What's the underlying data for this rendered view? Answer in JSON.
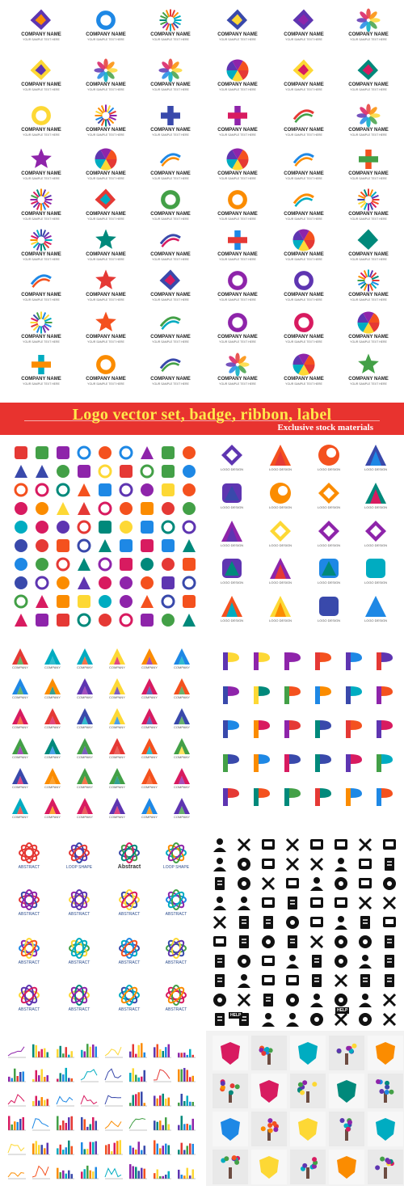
{
  "top_grid": {
    "company_name": "COMPANY NAME",
    "tagline": "YOUR SAMPLE TEXT HERE",
    "script_name": "Company Name"
  },
  "banner": {
    "title": "Logo vector set, badge, ribbon, label",
    "subtitle": "Exclusive stock materials"
  },
  "panel_logo_design": {
    "label": "LOGO DESIGN"
  },
  "panel_company": {
    "label": "COMPANY"
  },
  "panel_abstract": {
    "label": "ABSTRACT",
    "loop_shape": "LOOP SHAPE",
    "abstract_title": "Abstract"
  },
  "panel_icons": {
    "help_label": "HELP"
  },
  "colors": {
    "banner_red": "#e8332f",
    "banner_title_yellow": "#ffe94a",
    "icon_black": "#111111"
  }
}
